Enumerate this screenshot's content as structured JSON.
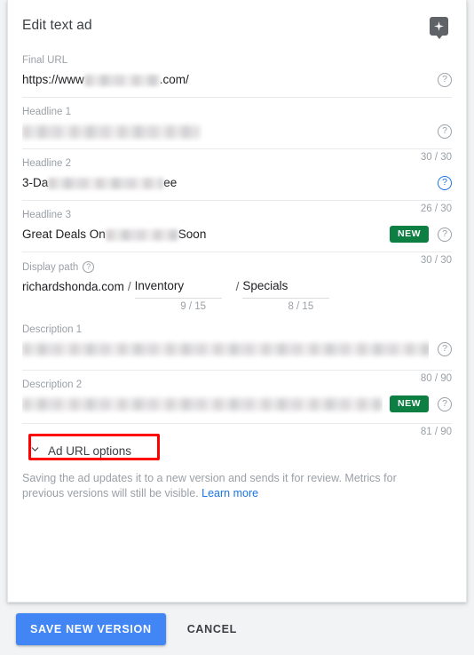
{
  "header": {
    "title": "Edit text ad",
    "ai_badge_icon": "sparkle-icon"
  },
  "fields": {
    "final_url": {
      "label": "Final URL",
      "value_prefix": "https://www",
      "value_suffix": ".com/",
      "redacted": true
    },
    "headline1": {
      "label": "Headline 1",
      "value_prefix": "",
      "value_suffix": "",
      "redacted": true,
      "counter": "30 / 30"
    },
    "headline2": {
      "label": "Headline 2",
      "value_prefix": "3-Da",
      "value_suffix": "ee",
      "redacted": true,
      "counter": "26 / 30",
      "focused": true
    },
    "headline3": {
      "label": "Headline 3",
      "value_prefix": "Great Deals On",
      "value_suffix": "Soon",
      "redacted": true,
      "counter": "30 / 30",
      "badge": "NEW"
    },
    "display_path": {
      "label": "Display path",
      "domain": "richardshonda.com",
      "separator": "/",
      "path1": "Inventory",
      "path2": "Specials",
      "counter1": "9 / 15",
      "counter2": "8 / 15"
    },
    "description1": {
      "label": "Description 1",
      "redacted": true,
      "counter": "80 / 90"
    },
    "description2": {
      "label": "Description 2",
      "redacted": true,
      "counter": "81 / 90",
      "badge": "NEW"
    }
  },
  "ad_url_options": {
    "label": "Ad URL options",
    "icon": "chevron-down-icon",
    "annotated": true,
    "annotation_color": "#ff0000"
  },
  "help_text": {
    "text": "Saving the ad updates it to a new version and sends it for review. Metrics for previous versions will still be visible. ",
    "link": "Learn more"
  },
  "footer": {
    "save_label": "SAVE NEW VERSION",
    "cancel_label": "CANCEL"
  },
  "icons": {
    "help": "?",
    "help_name": "help-icon"
  },
  "colors": {
    "primary": "#4285f4",
    "link": "#1a73e8",
    "badge_green": "#0d7f42",
    "annotation_red": "#ff0000",
    "label_gray": "#9aa0a6",
    "text_dark": "#202124"
  }
}
